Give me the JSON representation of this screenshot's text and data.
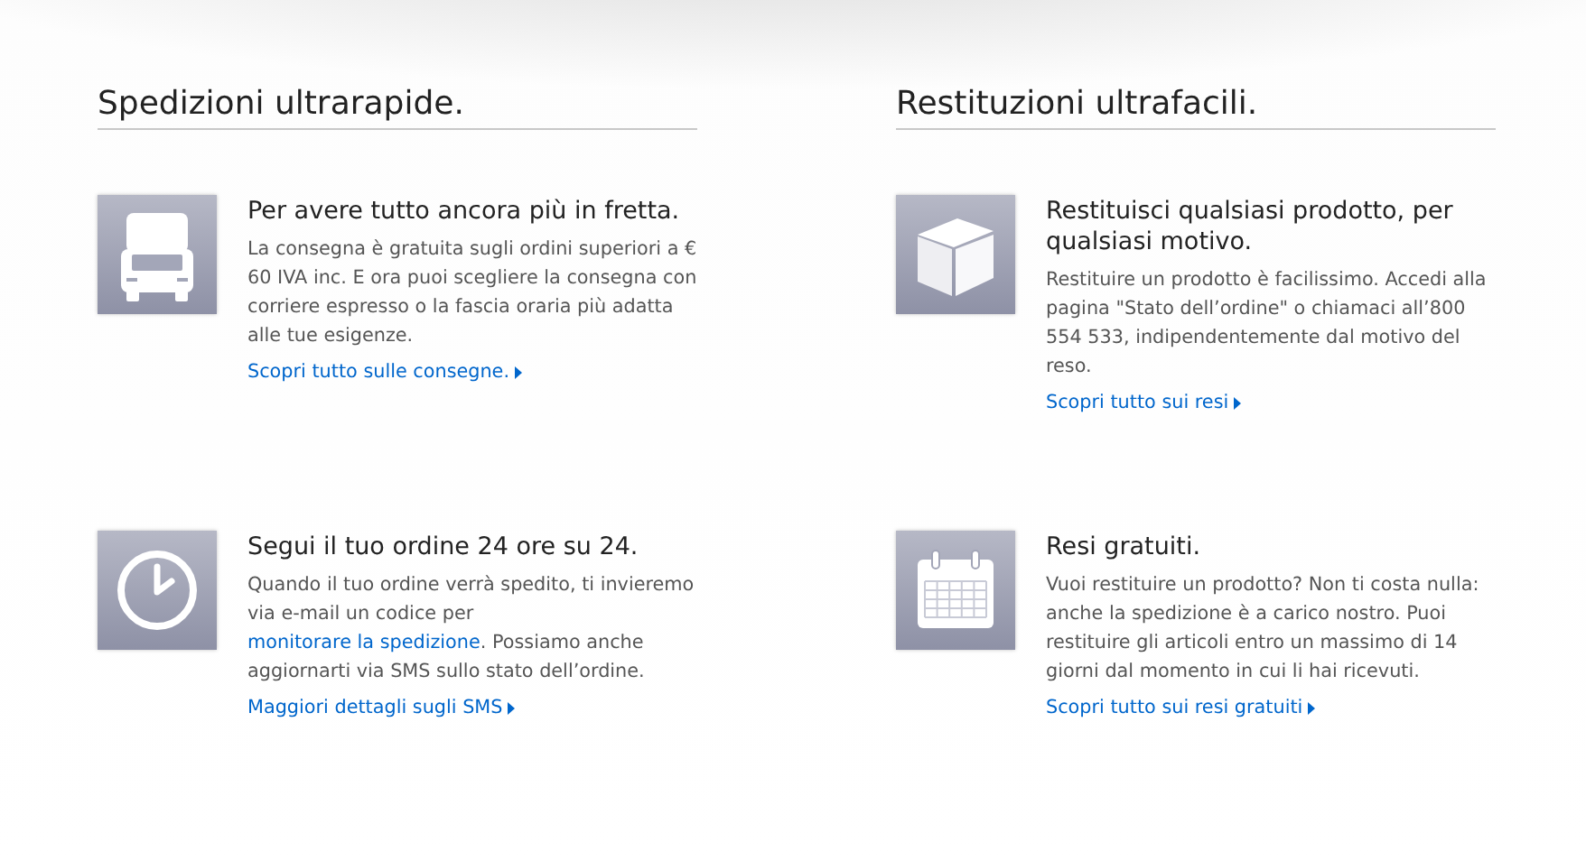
{
  "columns": [
    {
      "heading": "Spedizioni ultrarapide.",
      "features": [
        {
          "kind": "truck",
          "title": "Per avere tutto ancora più in fretta.",
          "body": [
            {
              "kind": "text",
              "text": "La consegna è gratuita sugli ordini superiori a € 60 IVA inc. E ora puoi scegliere la consegna con corriere espresso o la fascia oraria più adatta alle tue esigenze."
            }
          ],
          "link": "Scopri tutto sulle consegne."
        },
        {
          "kind": "clock",
          "title": "Segui il tuo ordine 24 ore su 24.",
          "body": [
            {
              "kind": "text",
              "text": "Quando il tuo ordine verrà spedito, ti invieremo via e-mail un codice per "
            },
            {
              "kind": "link",
              "text": "monitorare la spedizione"
            },
            {
              "kind": "text",
              "text": ". Possiamo anche aggiornarti via SMS sullo stato dell’ordine."
            }
          ],
          "link": "Maggiori dettagli sugli SMS"
        }
      ]
    },
    {
      "heading": "Restituzioni ultrafacili.",
      "features": [
        {
          "kind": "box",
          "title": "Restituisci qualsiasi prodotto, per qualsiasi motivo.",
          "body": [
            {
              "kind": "text",
              "text": "Restituire un prodotto è facilissimo. Accedi alla pagina \"Stato dell’ordine\" o chiamaci all’800 554 533, indipendentemente dal motivo del reso."
            }
          ],
          "link": "Scopri tutto sui resi"
        },
        {
          "kind": "calendar",
          "title": "Resi gratuiti.",
          "body": [
            {
              "kind": "text",
              "text": "Vuoi restituire un prodotto? Non ti costa nulla: anche la spedizione è a carico nostro. Puoi restituire gli articoli entro un massimo di 14 giorni dal momento in cui li hai ricevuti."
            }
          ],
          "link": "Scopri tutto sui resi gratuiti"
        }
      ]
    }
  ]
}
